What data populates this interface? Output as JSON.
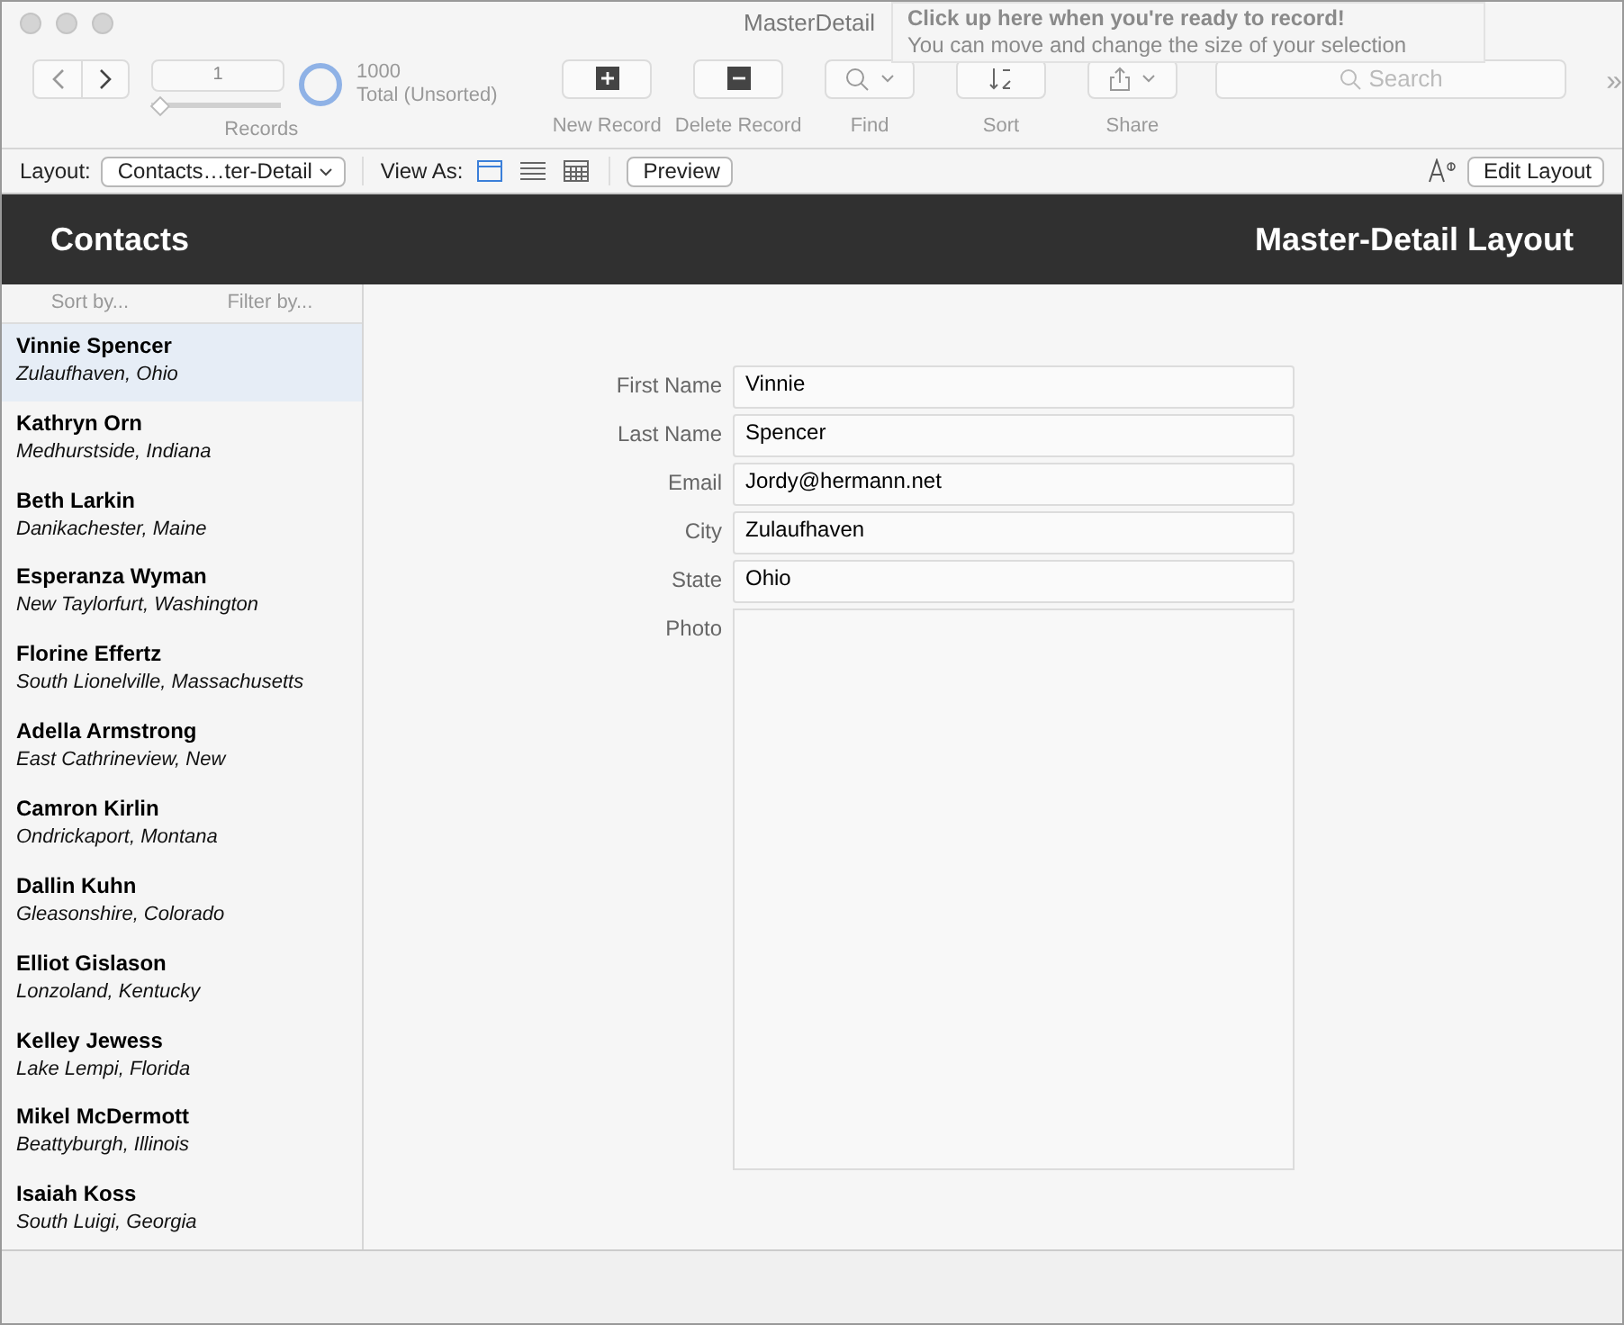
{
  "window": {
    "title": "MasterDetail"
  },
  "recording_hint": {
    "title": "Click up here when you're ready to record!",
    "subtitle": "You can move and change the size of your selection"
  },
  "toolbar": {
    "record_number": "1",
    "found_count": "1000",
    "found_status": "Total (Unsorted)",
    "records_label": "Records",
    "slider": {
      "level": 0
    },
    "buttons": [
      {
        "kind": "new",
        "label": "New Record"
      },
      {
        "kind": "delete",
        "label": "Delete Record"
      },
      {
        "kind": "find",
        "label": "Find"
      },
      {
        "kind": "sort",
        "label": "Sort"
      },
      {
        "kind": "share",
        "label": "Share"
      }
    ],
    "search": {
      "placeholder": "Search"
    },
    "overflow": "»"
  },
  "layout_bar": {
    "layout_label": "Layout:",
    "layout_value": "Contacts…ter-Detail",
    "view_as_label": "View As:",
    "views": [
      {
        "kind": "form",
        "selected": true
      },
      {
        "kind": "list",
        "selected": false
      },
      {
        "kind": "table",
        "selected": false
      }
    ],
    "preview": "Preview",
    "edit_layout": "Edit Layout"
  },
  "header": {
    "title": "Contacts",
    "layout_name": "Master-Detail Layout"
  },
  "list": {
    "sort": "Sort by...",
    "filter": "Filter by...",
    "items": [
      {
        "name": "Vinnie Spencer",
        "place": "Zulaufhaven, Ohio",
        "selected": true
      },
      {
        "name": "Kathryn Orn",
        "place": "Medhurstside, Indiana",
        "selected": false
      },
      {
        "name": "Beth Larkin",
        "place": "Danikachester, Maine",
        "selected": false
      },
      {
        "name": "Esperanza Wyman",
        "place": "New Taylorfurt, Washington",
        "selected": false
      },
      {
        "name": "Florine Effertz",
        "place": "South Lionelville, Massachusetts",
        "selected": false
      },
      {
        "name": "Adella Armstrong",
        "place": "East Cathrineview, New",
        "selected": false
      },
      {
        "name": "Camron Kirlin",
        "place": "Ondrickaport, Montana",
        "selected": false
      },
      {
        "name": "Dallin Kuhn",
        "place": "Gleasonshire, Colorado",
        "selected": false
      },
      {
        "name": "Elliot Gislason",
        "place": "Lonzoland, Kentucky",
        "selected": false
      },
      {
        "name": "Kelley Jewess",
        "place": "Lake Lempi, Florida",
        "selected": false
      },
      {
        "name": "Mikel McDermott",
        "place": "Beattyburgh, Illinois",
        "selected": false
      },
      {
        "name": "Isaiah Koss",
        "place": "South Luigi, Georgia",
        "selected": false
      }
    ]
  },
  "detail": {
    "fields": [
      {
        "label": "First Name",
        "value": "Vinnie"
      },
      {
        "label": "Last Name",
        "value": "Spencer"
      },
      {
        "label": "Email",
        "value": "Jordy@hermann.net"
      },
      {
        "label": "City",
        "value": "Zulaufhaven"
      },
      {
        "label": "State",
        "value": "Ohio"
      }
    ],
    "photo_label": "Photo"
  }
}
